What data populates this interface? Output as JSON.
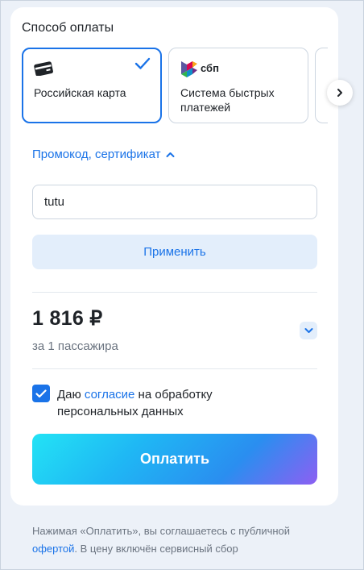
{
  "payment": {
    "title": "Способ оплаты",
    "methods": [
      {
        "label": "Российская карта",
        "icon": "credit-card-icon",
        "selected": true
      },
      {
        "label": "Система быстрых платежей",
        "icon": "sbp-logo-icon",
        "logo_text": "сбп",
        "selected": false
      }
    ]
  },
  "promo": {
    "toggle_label": "Промокод, сертификат",
    "input_value": "tutu",
    "apply_label": "Применить"
  },
  "price": {
    "amount": "1 816 ₽",
    "subtitle": "за 1 пассажира"
  },
  "consent": {
    "checked": true,
    "text_before": "Даю ",
    "link_text": "согласие",
    "text_after": " на обработку персональных данных"
  },
  "pay_button_label": "Оплатить",
  "footer": {
    "text_before": "Нажимая «Оплатить», вы соглашаетесь с публичной ",
    "link_text": "офертой",
    "text_after": ". В цену включён сервисный сбор"
  },
  "colors": {
    "accent": "#1a73e8",
    "background": "#ecf1f8",
    "apply_bg": "#e3eefb"
  }
}
